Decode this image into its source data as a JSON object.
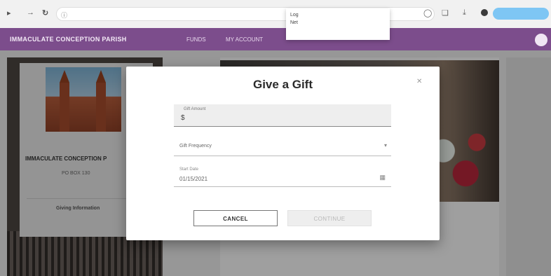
{
  "browser": {
    "url": "",
    "autocomplete": [
      "Log",
      "Net",
      ""
    ],
    "profile_pill": ""
  },
  "header": {
    "brand": "IMMACULATE CONCEPTION PARISH",
    "nav": [
      "FUNDS",
      "MY ACCOUNT"
    ],
    "user_name": "",
    "user_initial": ""
  },
  "parish": {
    "name": "IMMACULATE CONCEPTION P",
    "address_lines": [
      "PO BOX 130",
      ""
    ],
    "giving_title": "Giving Information",
    "giving_lines": [
      "",
      ""
    ]
  },
  "dialog": {
    "title": "Give a Gift",
    "amount_label": "Gift Amount",
    "amount_value": "$",
    "frequency_placeholder": "Gift Frequency",
    "date_label": "Start Date",
    "date_value": "01/15/2021",
    "cancel_label": "CANCEL",
    "continue_label": "CONTINUE"
  },
  "colors": {
    "header": "#7c4d8c",
    "overlay": "rgba(0,0,0,0.35)",
    "dialog_bg": "#ffffff"
  }
}
